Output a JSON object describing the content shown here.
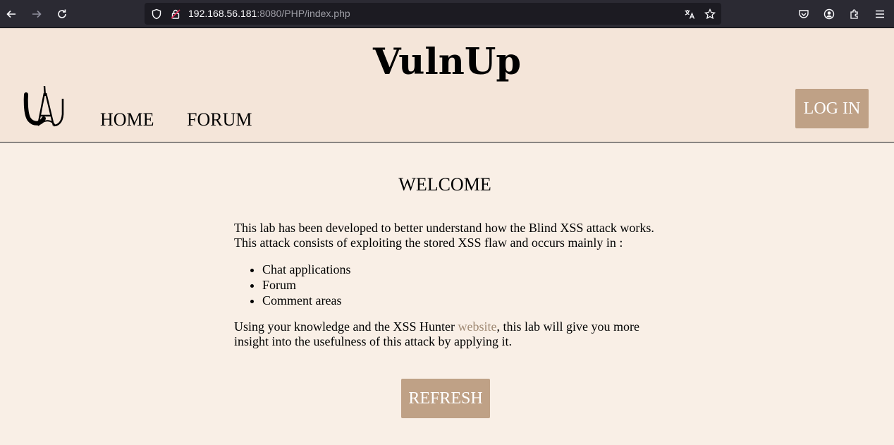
{
  "browser": {
    "url_host": "192.168.56.181",
    "url_rest": ":8080/PHP/index.php",
    "icons": [
      "back-icon",
      "forward-icon",
      "reload-icon",
      "shield-icon",
      "lock-insecure-icon",
      "translate-icon",
      "bookmark-star-icon",
      "pocket-icon",
      "account-icon",
      "extensions-icon",
      "menu-icon"
    ]
  },
  "header": {
    "title": "VulnUp",
    "nav": {
      "home": "HOME",
      "forum": "FORUM"
    },
    "login_label": "LOG IN"
  },
  "main": {
    "heading": "WELCOME",
    "intro_line1": "This lab has been developed to better understand how the Blind XSS attack works.",
    "intro_line2": "This attack consists of exploiting the stored XSS flaw and occurs mainly in :",
    "list": [
      "Chat applications",
      "Forum",
      "Comment areas"
    ],
    "outro_before": "Using your knowledge and the XSS Hunter ",
    "outro_link": "website",
    "outro_after": ", this lab will give you more insight into the usefulness of this attack by applying it.",
    "refresh_label": "REFRESH"
  },
  "colors": {
    "header_bg": "#f4e5d9",
    "page_bg": "#f9efe6",
    "button_bg": "#bfa186",
    "link": "#a08a74"
  }
}
